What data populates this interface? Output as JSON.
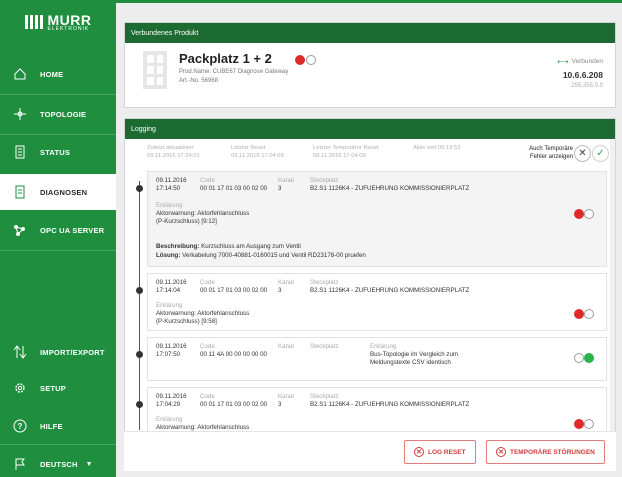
{
  "brand": {
    "name": "MURR",
    "sub": "ELEKTRONIK"
  },
  "sidebar": {
    "items": [
      {
        "label": "HOME",
        "icon": "home-icon"
      },
      {
        "label": "TOPOLOGIE",
        "icon": "topology-icon"
      },
      {
        "label": "STATUS",
        "icon": "status-icon"
      },
      {
        "label": "DIAGNOSEN",
        "icon": "diagnosis-icon"
      },
      {
        "label": "OPC UA SERVER",
        "icon": "opc-server-icon"
      },
      {
        "label": "IMPORT/EXPORT",
        "icon": "import-export-icon"
      },
      {
        "label": "SETUP",
        "icon": "gear-icon"
      },
      {
        "label": "HILFE",
        "icon": "help-icon"
      },
      {
        "label": "DEUTSCH",
        "icon": "flag-icon"
      }
    ]
  },
  "product": {
    "header": "Verbundenes Produkt",
    "title": "Packplatz 1 + 2",
    "prod_name": "Prod.Name: CUBE67 Diagnose Gateway",
    "art_no": "Art.-No. 56968",
    "conn_status": "Verbunden",
    "ip": "10.6.6.208",
    "mask": "255.255.0.0"
  },
  "logging": {
    "header": "Logging",
    "meta": [
      {
        "label": "Zuletzt aktualisiert",
        "value": "09.11.2016 17:24:01"
      },
      {
        "label": "Letzter Reset",
        "value": "09.11.2016 17:04:09"
      },
      {
        "label": "Letzter Temporärer Reset",
        "value": "09.11.2016 17:04:09"
      },
      {
        "label": "Aktiv seit 00:19:53",
        "value": ""
      }
    ],
    "temp_toggle_label_1": "Auch Temporäre",
    "temp_toggle_label_2": "Fehler anzeigen",
    "entries": [
      {
        "date": "09.11.2016",
        "time": "17:14:50",
        "code_label": "Code",
        "code": "00 01 17 01 03 00 02 00",
        "kanal_label": "Kanal",
        "kanal": "3",
        "steck_label": "Steckplatz",
        "steck": "B2.S1 1126K4 - ZUFUEHRUNG KOMMISSIONIERPLATZ",
        "erk_label": "Erklärung",
        "erk1": "Aktorwarnung: Aktorfehlanschluss",
        "erk2": "(P-Kurzschluss) [9:12]",
        "desc_label": "Beschreibung:",
        "desc": "Kurzschluss am Ausgang zum Ventil",
        "sol_label": "Lösung:",
        "sol": "Verkabelung 7000-40881-0160015 und Ventil RD23178-00 pruefen",
        "state": "error"
      },
      {
        "date": "09.11.2016",
        "time": "17:14:04",
        "code_label": "Code",
        "code": "00 01 17 01 03 00 02 00",
        "kanal_label": "Kanal",
        "kanal": "3",
        "steck_label": "Steckplatz",
        "steck": "B2.S1 1126K4 - ZUFUEHRUNG KOMMISSIONIERPLATZ",
        "erk_label": "Erklärung",
        "erk1": "Aktorwarnung: Aktorfehlanschluss",
        "erk2": "(P-Kurzschluss) [9:58]",
        "state": "error"
      },
      {
        "date": "09.11.2016",
        "time": "17:07:50",
        "code_label": "Code",
        "code": "00 11 4A 00 00 00 00 00",
        "kanal_label": "Kanal",
        "kanal": "",
        "steck_label": "Steckplatz",
        "steck": "",
        "erk_label": "Erklärung",
        "erk1": "Bus-Topologie im Vergleich zum",
        "erk2": "Meldungstexte CSV identisch",
        "state": "ok"
      },
      {
        "date": "09.11.2016",
        "time": "17:04:29",
        "code_label": "Code",
        "code": "00 01 17 01 03 00 02 00",
        "kanal_label": "Kanal",
        "kanal": "3",
        "steck_label": "Steckplatz",
        "steck": "B2.S1 1126K4 - ZUFUEHRUNG KOMMISSIONIERPLATZ",
        "erk_label": "Erklärung",
        "erk1": "Aktorwarnung: Aktorfehlanschluss",
        "state": "error"
      }
    ]
  },
  "actions": {
    "log_reset": "LOG RESET",
    "temp_faults": "TEMPORÄRE STÖRUNGEN"
  },
  "colors": {
    "brand_green": "#1f8f3f",
    "header_green": "#1c6b32",
    "error_red": "#e02a2a",
    "ok_green": "#29b34a"
  }
}
